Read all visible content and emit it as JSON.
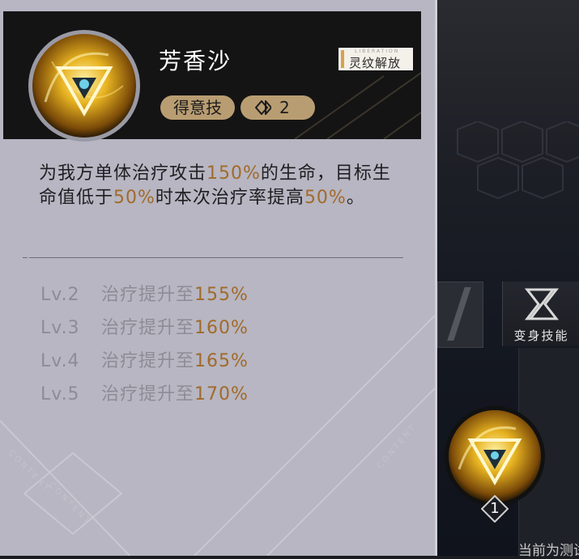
{
  "card": {
    "skill_name": "芳香沙",
    "tags": {
      "skill_type": "得意技",
      "cost_value": "2"
    },
    "liberation": {
      "en": "LIBERATION",
      "cn": "灵纹解放"
    },
    "description": {
      "part1": "为我方单体治疗攻击",
      "value1": "150%",
      "part2": "的生命，目标生命值低于",
      "value2": "50%",
      "part3": "时本次治疗率提高",
      "value3": "50%",
      "part4": "。"
    },
    "levels": [
      {
        "level": "Lv.2",
        "text": "治疗提升至",
        "value": "155%"
      },
      {
        "level": "Lv.3",
        "text": "治疗提升至",
        "value": "160%"
      },
      {
        "level": "Lv.4",
        "text": "治疗提升至",
        "value": "165%"
      },
      {
        "level": "Lv.5",
        "text": "治疗提升至",
        "value": "170%"
      }
    ],
    "watermark": "CONTENT"
  },
  "side": {
    "transform_skill_label": "变身技能",
    "skill_level": "1",
    "bottom_text": "当前为测试"
  },
  "colors": {
    "accent_gold": "#b99d72",
    "highlight": "#a26a2a",
    "card_bg": "#b7b6c2",
    "header_bg": "#151414"
  },
  "icons": {
    "skill": "golden-triangle-eye-icon",
    "cost": "diamond-link-icon",
    "transform": "transform-x-icon",
    "level": "diamond-badge-icon"
  }
}
